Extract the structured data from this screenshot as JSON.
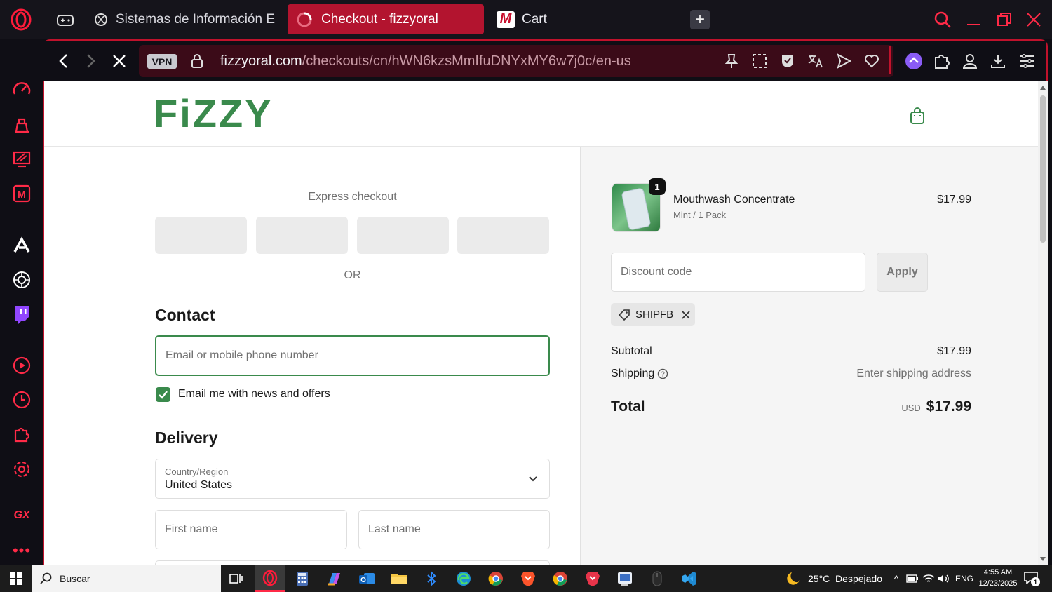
{
  "browser": {
    "tabs": [
      {
        "label": "Sistemas de Información E"
      },
      {
        "label": "Checkout - fizzyoral"
      },
      {
        "label": "Cart"
      }
    ],
    "vpn_badge": "VPN",
    "url_domain": "fizzyoral.com",
    "url_path": "/checkouts/cn/hWN6kzsMmIfuDNYxMY6w7j0c/en-us",
    "sidebar_gx": "GX"
  },
  "page": {
    "logo_text": "FiZZY",
    "express_checkout": "Express checkout",
    "or": "OR",
    "contact_heading": "Contact",
    "email_placeholder": "Email or mobile phone number",
    "newsletter_label": "Email me with news and offers",
    "delivery_heading": "Delivery",
    "country_label": "Country/Region",
    "country_value": "United States",
    "first_name_placeholder": "First name",
    "last_name_placeholder": "Last name"
  },
  "summary": {
    "item": {
      "name": "Mouthwash Concentrate",
      "variant": "Mint / 1 Pack",
      "price": "$17.99",
      "quantity": "1"
    },
    "discount_placeholder": "Discount code",
    "apply_label": "Apply",
    "applied_code": "SHIPFB",
    "subtotal_label": "Subtotal",
    "subtotal_value": "$17.99",
    "shipping_label": "Shipping",
    "shipping_value": "Enter shipping address",
    "total_label": "Total",
    "total_currency": "USD",
    "total_value": "$17.99"
  },
  "taskbar": {
    "search_placeholder": "Buscar",
    "weather": "25°C  Despejado",
    "language": "ENG",
    "time": "4:55 AM",
    "date": "12/23/2025",
    "notifications": "1"
  },
  "colors": {
    "brand_green": "#3a8a4c",
    "opera_red": "#c0122c",
    "tab_active": "#b3142f"
  }
}
